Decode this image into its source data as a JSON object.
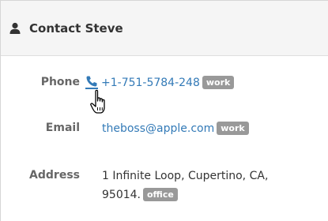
{
  "panel": {
    "title": "Contact Steve",
    "header_icon": "user-icon"
  },
  "fields": {
    "phone": {
      "label": "Phone",
      "icon": "phone-icon",
      "value": "+1-751-5784-248",
      "tag": "work"
    },
    "email": {
      "label": "Email",
      "value": "theboss@apple.com",
      "tag": "work"
    },
    "address": {
      "label": "Address",
      "line1": "1 Infinite Loop, Cupertino, CA,",
      "line2": "95014.",
      "tag": "office"
    }
  },
  "cursor": "hand-pointer-icon",
  "colors": {
    "link": "#337ab7",
    "badge": "#999999",
    "header_bg": "#f5f5f5"
  }
}
